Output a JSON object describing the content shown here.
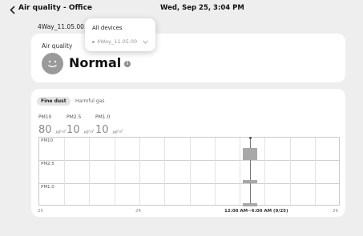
{
  "header": {
    "title": "Air quality - Office",
    "datetime": "Wed, Sep 25, 3:04 PM"
  },
  "device": {
    "selected": "4Way_11.05.00"
  },
  "dropdown": {
    "title": "All devices",
    "item": "4Way_11.05.00"
  },
  "air_quality": {
    "label": "Air quality",
    "status": "Normal",
    "info_glyph": "i",
    "face_icon": "smiley-face-icon"
  },
  "tabs": [
    {
      "label": "Fine dust",
      "active": true
    },
    {
      "label": "Harmful gas",
      "active": false
    }
  ],
  "pm": [
    {
      "name": "PM10",
      "value": "80",
      "unit": "㎍/㎥"
    },
    {
      "name": "PM2.5",
      "value": "10",
      "unit": "㎍/㎥"
    },
    {
      "name": "PM1.0",
      "value": "10",
      "unit": "㎍/㎥"
    }
  ],
  "chart": {
    "rows": [
      "PM10",
      "PM2.5",
      "PM1.0"
    ],
    "ticks": [
      "25",
      "24",
      "12:00 AM~6:00 AM (9/25)",
      "26"
    ]
  },
  "colors": {
    "background": "#eeeeee",
    "card": "#ffffff",
    "mark": "#a8a8a8"
  }
}
